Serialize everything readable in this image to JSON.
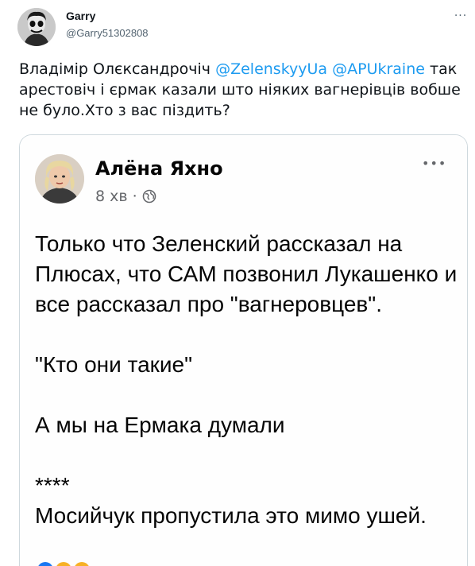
{
  "tweet": {
    "author_name": "Garry",
    "author_handle": "@Garry51302808",
    "more_label": "···",
    "text_part1": "Владімір Олєксандрочіч",
    "mention1": "@ZelenskyyUa",
    "mention2": "@APUkraine",
    "text_part2": "так арестовіч і єрмак казали што ніяких вагнерівців вобше не було.Хто з вас піздить?"
  },
  "embedded_post": {
    "author": "Алёна Яхно",
    "time": "8 хв",
    "separator": "·",
    "globe_icon": "globe-icon",
    "more_label": "•••",
    "paragraph1": "Только что Зеленский рассказал на Плюсах, что САМ позвонил Лукашенко и все рассказал про \"вагнеровцев\".",
    "paragraph2": "\"Кто они такие\"",
    "paragraph3": "А мы на Ермака думали",
    "stars": "****",
    "paragraph4": "Мосийчук пропустила это мимо ушей."
  },
  "colors": {
    "mention": "#1d9bf0",
    "text": "#0f1419",
    "secondary": "#536471",
    "media_border": "#cfd9de"
  }
}
